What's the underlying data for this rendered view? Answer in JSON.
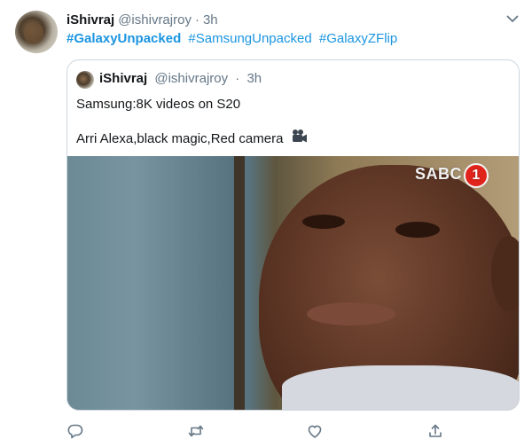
{
  "tweet": {
    "display_name": "iShivraj",
    "handle": "@ishivrajroy",
    "separator": "·",
    "time": "3h",
    "hashtags": [
      "#GalaxyUnpacked",
      "#SamsungUnpacked",
      "#GalaxyZFlip"
    ]
  },
  "quoted_tweet": {
    "display_name": "iShivraj",
    "handle": "@ishivrajroy",
    "separator": "·",
    "time": "3h",
    "line1": "Samsung:8K videos on S20",
    "line2": "Arri Alexa,black magic,Red camera",
    "media": {
      "watermark_text": "SABC",
      "watermark_number": "1"
    }
  },
  "icons": {
    "more": "chevron-down-icon",
    "reply": "reply-icon",
    "retweet": "retweet-icon",
    "like": "heart-icon",
    "share": "share-icon",
    "emoji": "movie-camera-icon"
  },
  "colors": {
    "link": "#1b95e0",
    "secondary_text": "#657786",
    "border": "#ccd6dd",
    "icon": "#657786"
  }
}
